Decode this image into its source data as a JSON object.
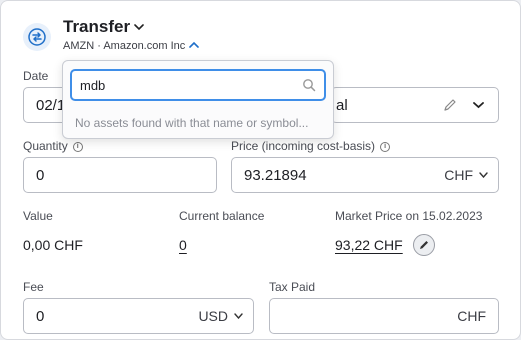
{
  "header": {
    "title": "Transfer",
    "subtitle": "AMZN · Amazon.com Inc"
  },
  "date": {
    "label": "Date",
    "value": "02/1"
  },
  "account": {
    "value_fragment": "al"
  },
  "quantity": {
    "label": "Quantity",
    "value": "0"
  },
  "price": {
    "label": "Price (incoming cost-basis)",
    "value": "93.21894",
    "currency": "CHF"
  },
  "value": {
    "label": "Value",
    "amount": "0,00 CHF"
  },
  "balance": {
    "label": "Current balance",
    "amount": "0"
  },
  "market": {
    "label": "Market Price on 15.02.2023",
    "amount": "93,22 CHF"
  },
  "fee": {
    "label": "Fee",
    "value": "0",
    "currency": "USD"
  },
  "tax": {
    "label": "Tax Paid",
    "value": "",
    "currency": "CHF"
  },
  "search": {
    "query": "mdb",
    "no_results": "No assets found with that name or symbol..."
  },
  "colors": {
    "accent": "#3f8ee8",
    "icon_blue": "#1f6fc9"
  }
}
